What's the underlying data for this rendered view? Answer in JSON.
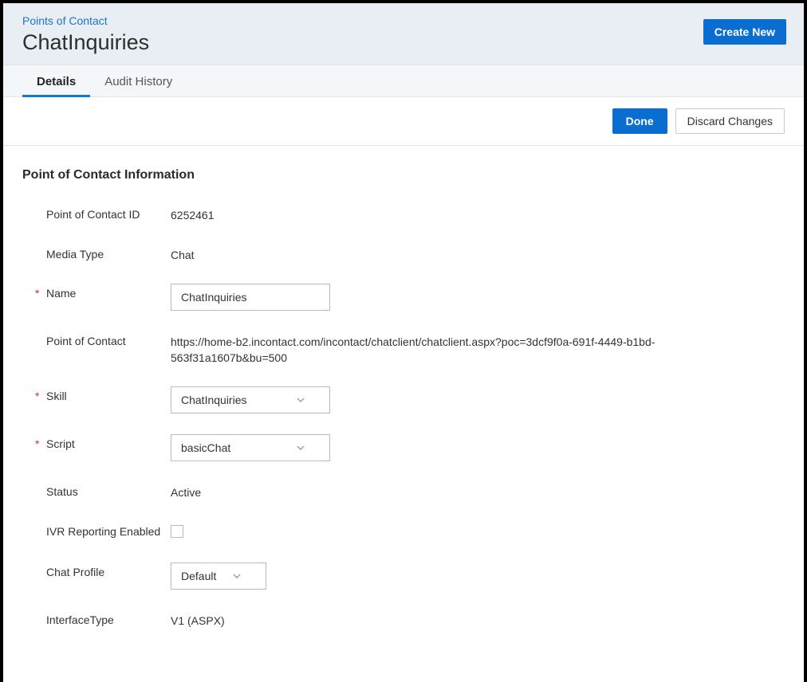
{
  "breadcrumb": "Points of Contact",
  "page_title": "ChatInquiries",
  "create_new_label": "Create New",
  "tabs": {
    "details": "Details",
    "audit_history": "Audit History"
  },
  "actions": {
    "done": "Done",
    "discard": "Discard Changes"
  },
  "section_title": "Point of Contact Information",
  "fields": {
    "poc_id_label": "Point of Contact ID",
    "poc_id_value": "6252461",
    "media_type_label": "Media Type",
    "media_type_value": "Chat",
    "name_label": "Name",
    "name_value": "ChatInquiries",
    "poc_label": "Point of Contact",
    "poc_value": "https://home-b2.incontact.com/incontact/chatclient/chatclient.aspx?poc=3dcf9f0a-691f-4449-b1bd-563f31a1607b&bu=500",
    "skill_label": "Skill",
    "skill_value": "ChatInquiries",
    "script_label": "Script",
    "script_value": "basicChat",
    "status_label": "Status",
    "status_value": "Active",
    "ivr_label": "IVR Reporting Enabled",
    "ivr_checked": false,
    "chat_profile_label": "Chat Profile",
    "chat_profile_value": "Default",
    "interface_type_label": "InterfaceType",
    "interface_type_value": "V1 (ASPX)"
  }
}
